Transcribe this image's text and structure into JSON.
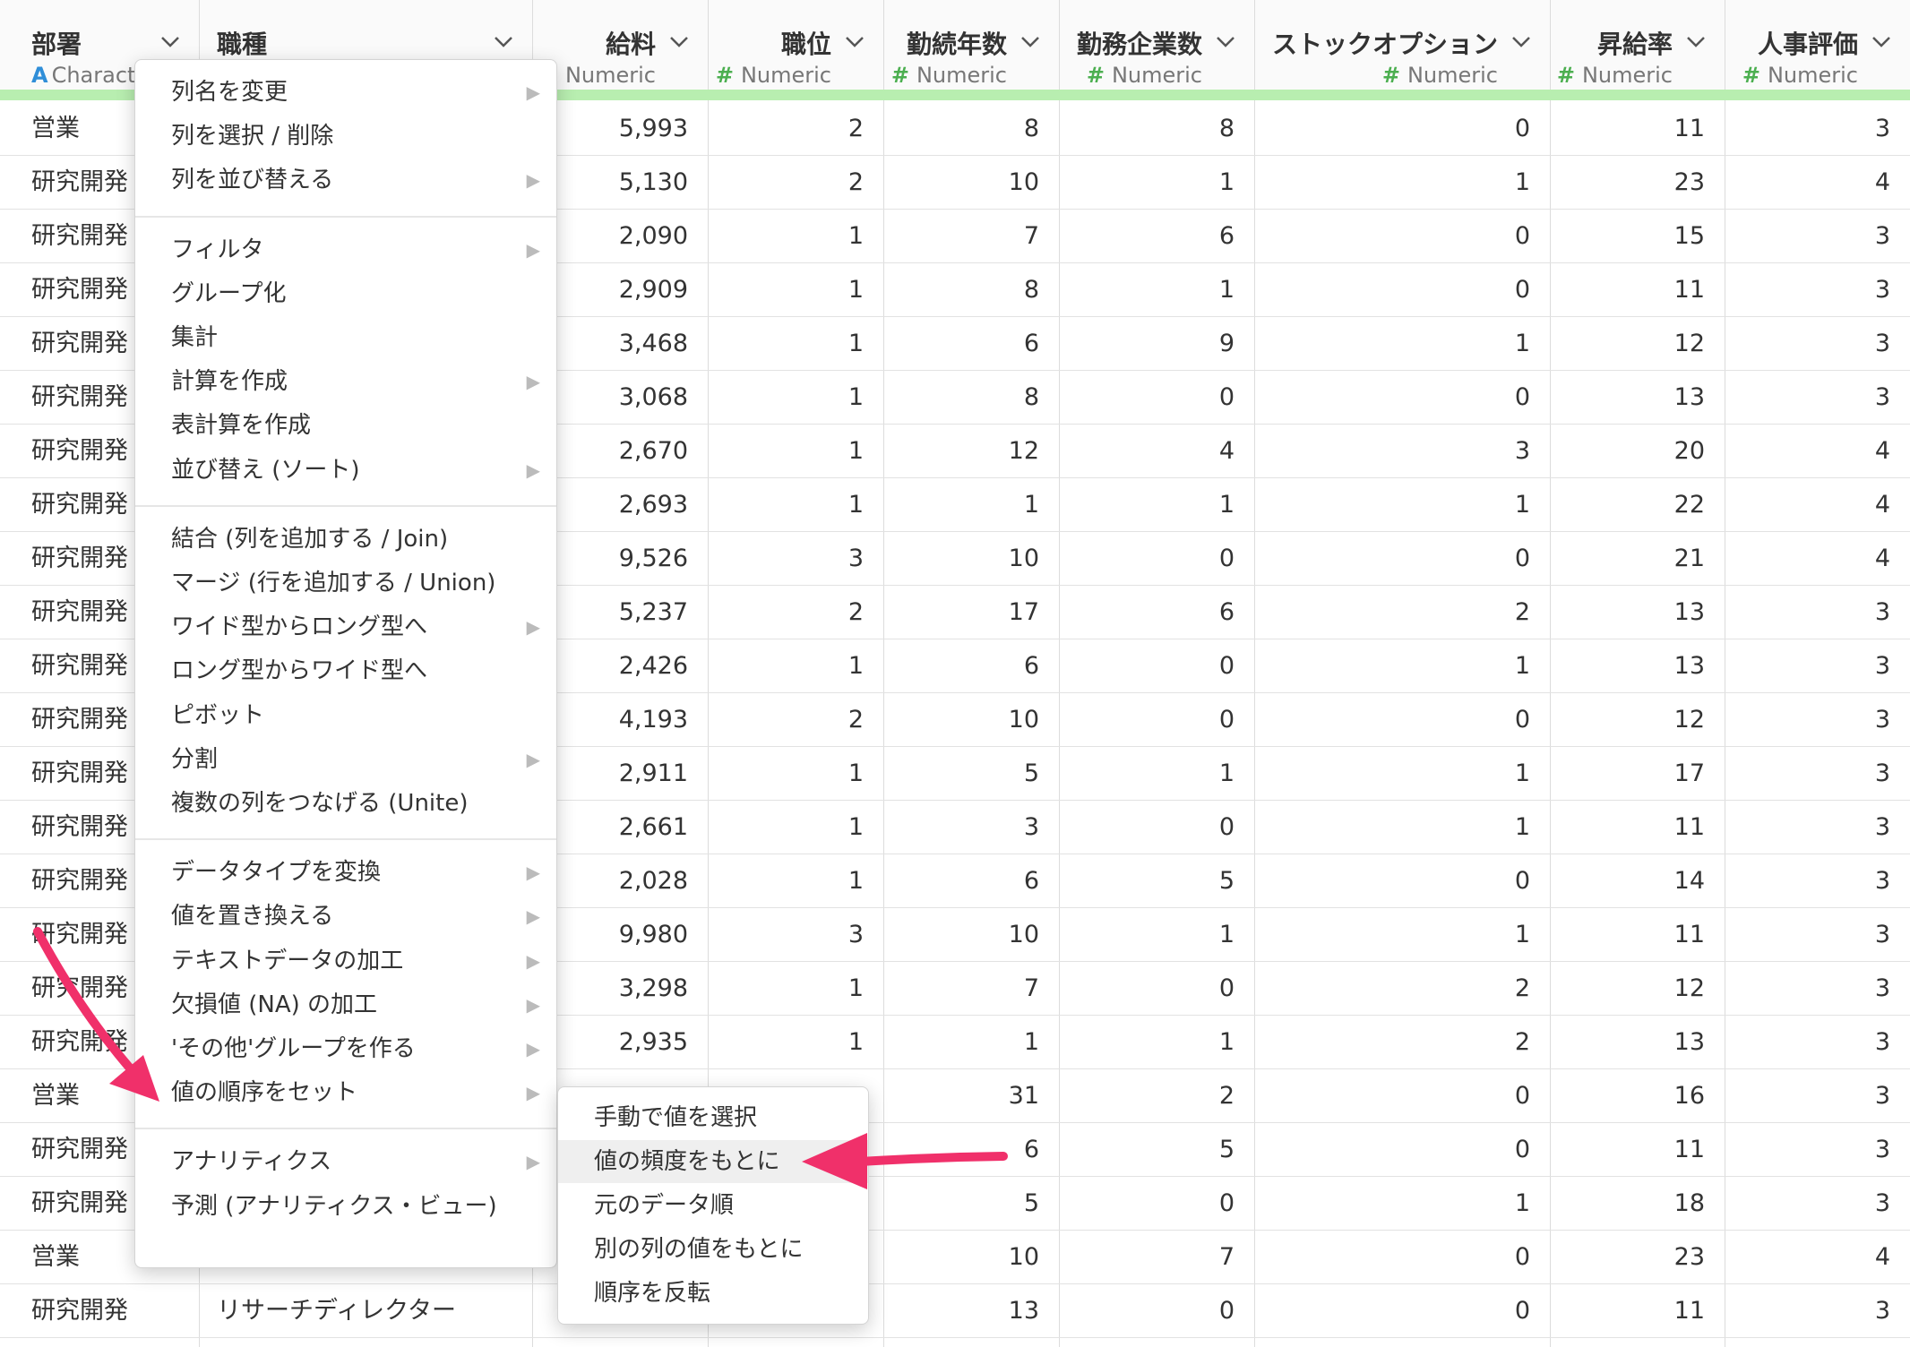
{
  "columns": [
    {
      "title": "部署",
      "type": "Character",
      "type_icon": "A"
    },
    {
      "title": "職種",
      "type": "",
      "type_icon": ""
    },
    {
      "title": "給料",
      "type": "Numeric",
      "type_icon": "#"
    },
    {
      "title": "職位",
      "type": "Numeric",
      "type_icon": "#"
    },
    {
      "title": "勤続年数",
      "type": "Numeric",
      "type_icon": "#"
    },
    {
      "title": "勤務企業数",
      "type": "Numeric",
      "type_icon": "#"
    },
    {
      "title": "ストックオプション",
      "type": "Numeric",
      "type_icon": "#"
    },
    {
      "title": "昇給率",
      "type": "Numeric",
      "type_icon": "#"
    },
    {
      "title": "人事評価",
      "type": "Numeric",
      "type_icon": "#"
    }
  ],
  "type_label_character": "Characte",
  "rows": [
    [
      "営業",
      "",
      "5,993",
      "2",
      "8",
      "8",
      "0",
      "11",
      "3"
    ],
    [
      "研究開発",
      "",
      "5,130",
      "2",
      "10",
      "1",
      "1",
      "23",
      "4"
    ],
    [
      "研究開発",
      "",
      "2,090",
      "1",
      "7",
      "6",
      "0",
      "15",
      "3"
    ],
    [
      "研究開発",
      "",
      "2,909",
      "1",
      "8",
      "1",
      "0",
      "11",
      "3"
    ],
    [
      "研究開発",
      "",
      "3,468",
      "1",
      "6",
      "9",
      "1",
      "12",
      "3"
    ],
    [
      "研究開発",
      "",
      "3,068",
      "1",
      "8",
      "0",
      "0",
      "13",
      "3"
    ],
    [
      "研究開発",
      "",
      "2,670",
      "1",
      "12",
      "4",
      "3",
      "20",
      "4"
    ],
    [
      "研究開発",
      "",
      "2,693",
      "1",
      "1",
      "1",
      "1",
      "22",
      "4"
    ],
    [
      "研究開発",
      "",
      "9,526",
      "3",
      "10",
      "0",
      "0",
      "21",
      "4"
    ],
    [
      "研究開発",
      "",
      "5,237",
      "2",
      "17",
      "6",
      "2",
      "13",
      "3"
    ],
    [
      "研究開発",
      "",
      "2,426",
      "1",
      "6",
      "0",
      "1",
      "13",
      "3"
    ],
    [
      "研究開発",
      "",
      "4,193",
      "2",
      "10",
      "0",
      "0",
      "12",
      "3"
    ],
    [
      "研究開発",
      "",
      "2,911",
      "1",
      "5",
      "1",
      "1",
      "17",
      "3"
    ],
    [
      "研究開発",
      "",
      "2,661",
      "1",
      "3",
      "0",
      "1",
      "11",
      "3"
    ],
    [
      "研究開発",
      "",
      "2,028",
      "1",
      "6",
      "5",
      "0",
      "14",
      "3"
    ],
    [
      "研究開発",
      "",
      "9,980",
      "3",
      "10",
      "1",
      "1",
      "11",
      "3"
    ],
    [
      "研究開発",
      "",
      "3,298",
      "1",
      "7",
      "0",
      "2",
      "12",
      "3"
    ],
    [
      "研究開発",
      "",
      "2,935",
      "1",
      "1",
      "1",
      "2",
      "13",
      "3"
    ],
    [
      "営業",
      "",
      "",
      "",
      "31",
      "2",
      "0",
      "16",
      "3"
    ],
    [
      "研究開発",
      "",
      "",
      "",
      "6",
      "5",
      "0",
      "11",
      "3"
    ],
    [
      "研究開発",
      "",
      "",
      "",
      "5",
      "0",
      "1",
      "18",
      "3"
    ],
    [
      "営業",
      "",
      "",
      "",
      "10",
      "7",
      "0",
      "23",
      "4"
    ],
    [
      "研究開発",
      "リサーチディレクター",
      "",
      "",
      "13",
      "0",
      "0",
      "11",
      "3"
    ]
  ],
  "context_menu": {
    "groups": [
      [
        {
          "label": "列名を変更",
          "submenu": true
        },
        {
          "label": "列を選択 / 削除",
          "submenu": false
        },
        {
          "label": "列を並び替える",
          "submenu": true
        }
      ],
      [
        {
          "label": "フィルタ",
          "submenu": true
        },
        {
          "label": "グループ化",
          "submenu": false
        },
        {
          "label": "集計",
          "submenu": false
        },
        {
          "label": "計算を作成",
          "submenu": true
        },
        {
          "label": "表計算を作成",
          "submenu": false
        },
        {
          "label": "並び替え (ソート)",
          "submenu": true
        }
      ],
      [
        {
          "label": "結合 (列を追加する / Join)",
          "submenu": false
        },
        {
          "label": "マージ (行を追加する / Union)",
          "submenu": false
        },
        {
          "label": "ワイド型からロング型へ",
          "submenu": true
        },
        {
          "label": "ロング型からワイド型へ",
          "submenu": false
        },
        {
          "label": "ピボット",
          "submenu": false
        },
        {
          "label": "分割",
          "submenu": true
        },
        {
          "label": "複数の列をつなげる (Unite)",
          "submenu": false
        }
      ],
      [
        {
          "label": "データタイプを変換",
          "submenu": true
        },
        {
          "label": "値を置き換える",
          "submenu": true
        },
        {
          "label": "テキストデータの加工",
          "submenu": true
        },
        {
          "label": "欠損値 (NA) の加工",
          "submenu": true
        },
        {
          "label": "'その他'グループを作る",
          "submenu": true
        },
        {
          "label": "値の順序をセット",
          "submenu": true
        }
      ],
      [
        {
          "label": "アナリティクス",
          "submenu": true
        },
        {
          "label": "予測 (アナリティクス・ビュー)",
          "submenu": false
        }
      ]
    ]
  },
  "submenu": {
    "items": [
      {
        "label": "手動で値を選択",
        "highlighted": false
      },
      {
        "label": "値の頻度をもとに",
        "highlighted": true
      },
      {
        "label": "元のデータ順",
        "highlighted": false
      },
      {
        "label": "別の列の値をもとに",
        "highlighted": false
      },
      {
        "label": "順序を反転",
        "highlighted": false
      }
    ]
  },
  "colors": {
    "accent_arrow": "#f0306a",
    "green_bar": "#b8eeb0",
    "numeric_icon": "#4caf50",
    "character_icon": "#2f8ed8"
  }
}
